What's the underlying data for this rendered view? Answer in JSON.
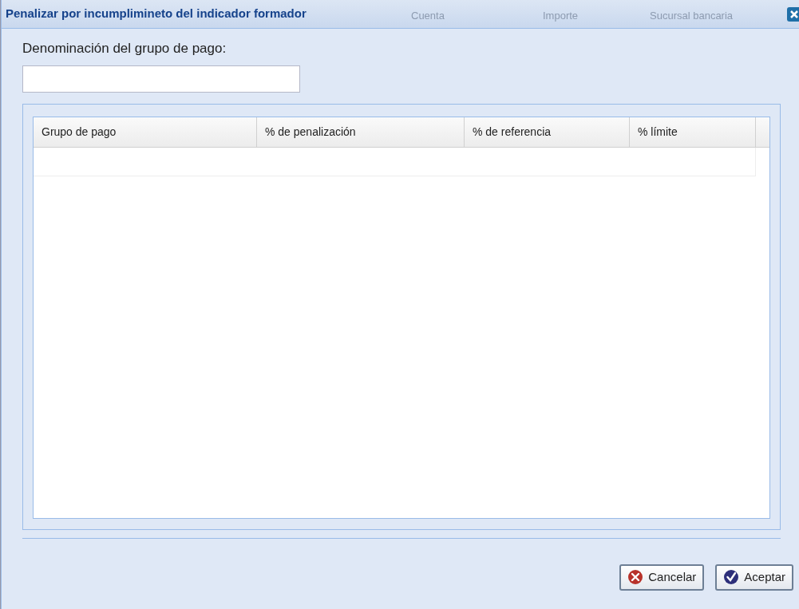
{
  "background_columns": [
    "Cuenta",
    "Importe",
    "Sucursal bancaria"
  ],
  "dialog": {
    "title": "Penalizar por incumplimineto del indicador formador"
  },
  "field": {
    "label": "Denominación del grupo de pago:"
  },
  "table": {
    "columns": [
      "Grupo de pago",
      "% de penalización",
      "% de referencia",
      "% límite"
    ]
  },
  "buttons": [
    {
      "kind": "cancel",
      "label": "Cancelar"
    },
    {
      "kind": "accept",
      "label": "Aceptar"
    }
  ]
}
